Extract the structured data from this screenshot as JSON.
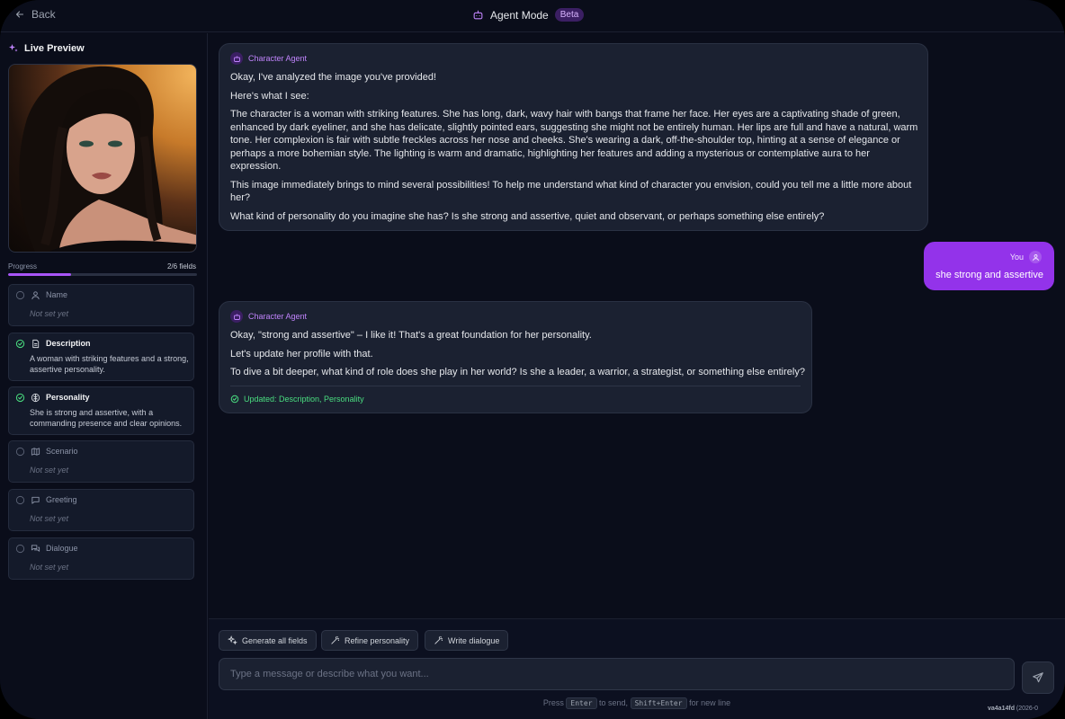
{
  "topbar": {
    "back_label": "Back",
    "mode_title": "Agent Mode",
    "badge": "Beta"
  },
  "sidebar": {
    "title": "Live Preview",
    "progress_label": "Progress",
    "progress_count": "2/6 fields",
    "progress_fraction": 0.333,
    "fields": [
      {
        "name": "Name",
        "value": "Not set yet",
        "set": false,
        "icon": "user-icon"
      },
      {
        "name": "Description",
        "value": "A woman with striking features and a strong, assertive personality.",
        "set": true,
        "icon": "document-icon"
      },
      {
        "name": "Personality",
        "value": "She is strong and assertive, with a commanding presence and clear opinions.",
        "set": true,
        "icon": "brain-icon"
      },
      {
        "name": "Scenario",
        "value": "Not set yet",
        "set": false,
        "icon": "map-icon"
      },
      {
        "name": "Greeting",
        "value": "Not set yet",
        "set": false,
        "icon": "chat-bubble-icon"
      },
      {
        "name": "Dialogue",
        "value": "Not set yet",
        "set": false,
        "icon": "chat-bubbles-icon"
      }
    ]
  },
  "chat": {
    "agent_name": "Character Agent",
    "user_name": "You",
    "messages": [
      {
        "role": "agent",
        "paragraphs": [
          "Okay, I've analyzed the image you've provided!",
          "Here's what I see:",
          "The character is a woman with striking features. She has long, dark, wavy hair with bangs that frame her face. Her eyes are a captivating shade of green, enhanced by dark eyeliner, and she has delicate, slightly pointed ears, suggesting she might not be entirely human. Her lips are full and have a natural, warm tone. Her complexion is fair with subtle freckles across her nose and cheeks. She's wearing a dark, off-the-shoulder top, hinting at a sense of elegance or perhaps a more bohemian style. The lighting is warm and dramatic, highlighting her features and adding a mysterious or contemplative aura to her expression.",
          "This image immediately brings to mind several possibilities! To help me understand what kind of character you envision, could you tell me a little more about her?",
          "What kind of personality do you imagine she has? Is she strong and assertive, quiet and observant, or perhaps something else entirely?"
        ]
      },
      {
        "role": "user",
        "text": "she strong and assertive"
      },
      {
        "role": "agent",
        "paragraphs": [
          "Okay, \"strong and assertive\" – I like it! That's a great foundation for her personality.",
          "Let's update her profile with that.",
          "To dive a bit deeper, what kind of role does she play in her world? Is she a leader, a warrior, a strategist, or something else entirely?"
        ],
        "updated": "Updated: Description, Personality"
      }
    ]
  },
  "composer": {
    "quick_actions": [
      "Generate all fields",
      "Refine personality",
      "Write dialogue"
    ],
    "placeholder": "Type a message or describe what you want...",
    "value": "",
    "hint_press": "Press",
    "hint_enter": "Enter",
    "hint_to_send": "to send,",
    "hint_shift_enter": "Shift+Enter",
    "hint_newline": "for new line",
    "version_hash": "va4a14fd",
    "version_date": "(2026-0"
  },
  "colors": {
    "accent": "#a855f7",
    "user_bubble": "#9333ea",
    "success": "#4ade80",
    "background": "#0a0d1a"
  }
}
